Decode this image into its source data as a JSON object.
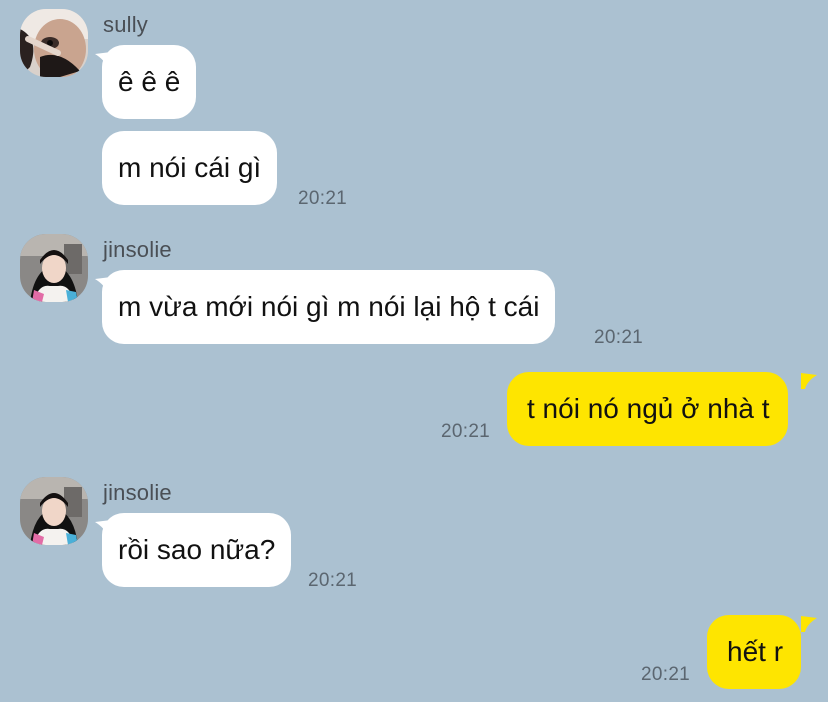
{
  "colors": {
    "background": "#abc1d1",
    "incoming_bubble": "#ffffff",
    "outgoing_bubble": "#fee500"
  },
  "messages": [
    {
      "sender": "sully",
      "text": "ê ê ê"
    },
    {
      "sender": "sully",
      "text": "m nói cái gì",
      "time": "20:21"
    },
    {
      "sender": "jinsolie",
      "text": "m vừa mới nói gì m nói lại hộ t cái",
      "time": "20:21"
    },
    {
      "sender": "me",
      "text": "t nói nó ngủ ở nhà t",
      "time": "20:21"
    },
    {
      "sender": "jinsolie",
      "text": "rồi sao nữa?",
      "time": "20:21"
    },
    {
      "sender": "me",
      "text": "hết r",
      "time": "20:21"
    }
  ],
  "icons": {
    "avatar_sully": "avatar-icon",
    "avatar_jinsolie": "avatar-icon"
  }
}
